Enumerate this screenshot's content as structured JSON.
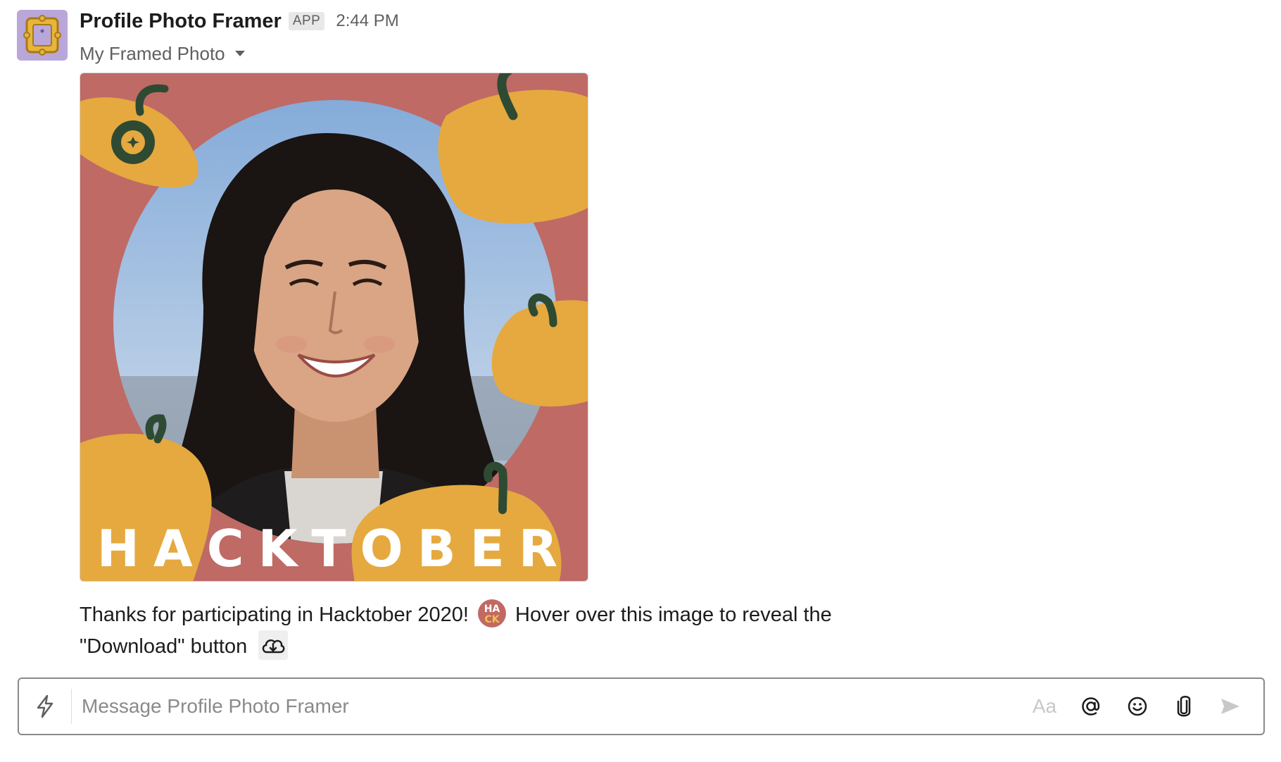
{
  "message": {
    "sender_name": "Profile Photo Framer",
    "app_badge": "APP",
    "timestamp": "2:44 PM",
    "attachment_title": "My Framed Photo",
    "image": {
      "banner_text": "HACKTOBER",
      "frame_color": "#bf6a65",
      "pumpkin_color": "#e5a93f",
      "stem_color": "#2e4a33"
    },
    "text_line1_before": "Thanks for participating in Hacktober 2020!",
    "emoji_hack_top": "HA",
    "emoji_hack_bottom": "CK",
    "text_line1_after": "Hover over this image to reveal the",
    "text_line2": "\"Download\" button"
  },
  "composer": {
    "placeholder": "Message Profile Photo Framer",
    "format_label": "Aa"
  },
  "colors": {
    "text_primary": "#1d1c1d",
    "text_secondary": "#616061",
    "avatar_bg": "#b9a7d9"
  }
}
